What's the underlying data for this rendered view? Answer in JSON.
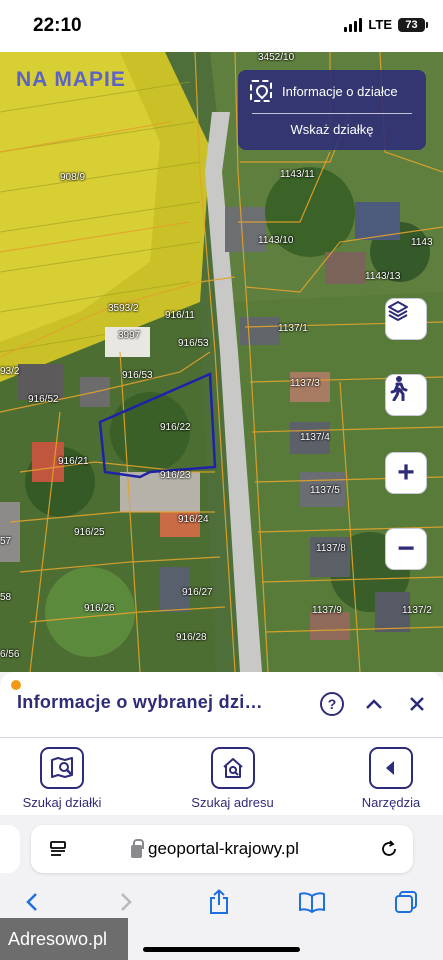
{
  "status_bar": {
    "time": "22:10",
    "network": "LTE",
    "battery": "73"
  },
  "map": {
    "logo": "NA MAPIE",
    "info_panel": {
      "title": "Informacje o działce",
      "action": "Wskaż działkę"
    },
    "parcels": [
      "3452/10",
      "908/9",
      "1143/11",
      "1143/10",
      "1143/13",
      "1143",
      "3593/2",
      "3997",
      "916/11",
      "916/53",
      "1137/1",
      "93/2",
      "916/52",
      "916/53",
      "1137/3",
      "916/22",
      "1137/4",
      "916/21",
      "916/23",
      "1137/5",
      "916/24",
      "916/25",
      "1137/8",
      "57",
      "58",
      "916/27",
      "916/26",
      "1137/9",
      "1137/2",
      "916/28",
      "6/56"
    ],
    "controls": [
      "layers-icon",
      "street-view-icon",
      "zoom-in-icon",
      "zoom-out-icon"
    ],
    "zoom_in_label": "+",
    "zoom_out_label": "−"
  },
  "sheet": {
    "title": "Informacje o wybranej dzi…",
    "tools": [
      {
        "label": "Szukaj działki",
        "icon": "map-search-icon"
      },
      {
        "label": "Szukaj adresu",
        "icon": "home-search-icon"
      },
      {
        "label": "Narzędzia",
        "icon": "tools-arrow-icon"
      }
    ]
  },
  "browser": {
    "url": "geoportal-krajowy.pl",
    "watermark": "Adresowo.pl"
  }
}
